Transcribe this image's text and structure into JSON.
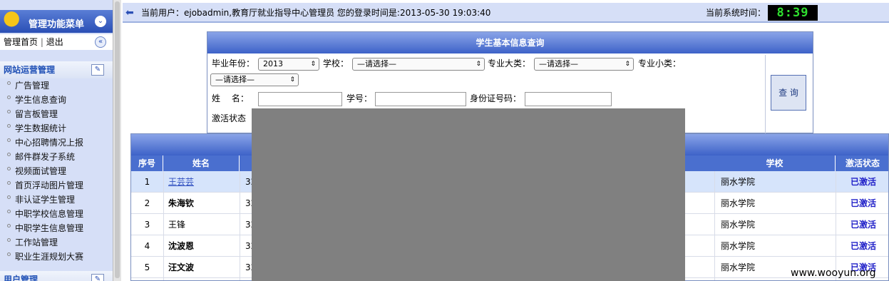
{
  "sidebar": {
    "title": "管理功能菜单",
    "home_link": "管理首页",
    "logout_link": "退出",
    "section_label": "网站运营管理",
    "items": [
      {
        "label": "广告管理"
      },
      {
        "label": "学生信息查询"
      },
      {
        "label": "留言板管理"
      },
      {
        "label": "学生数据统计"
      },
      {
        "label": "中心招聘情况上报"
      },
      {
        "label": "邮件群发子系统"
      },
      {
        "label": "视频面试管理"
      },
      {
        "label": "首页浮动图片管理"
      },
      {
        "label": "非认证学生管理"
      },
      {
        "label": "中职学校信息管理"
      },
      {
        "label": "中职学生信息管理"
      },
      {
        "label": "工作站管理"
      },
      {
        "label": "职业生涯规划大赛"
      }
    ],
    "section2_label": "用户管理"
  },
  "topbar": {
    "user_info": "当前用户：ejobadmin,教育厅就业指导中心管理员 您的登录时间是:2013-05-30 19:03:40",
    "time_label": "当前系统时间：",
    "clock": "8:39"
  },
  "query": {
    "title": "学生基本信息查询",
    "year_label": "毕业年份：",
    "year_value": "2013",
    "school_label": "学校：",
    "school_value": "—请选择—",
    "major_label": "专业大类：",
    "major_value": "—请选择—",
    "minor_label": "专业小类：",
    "minor_value": "—请选择—",
    "name_label": "姓　 名：",
    "id_label": "学号：",
    "idcard_label": "身份证号码：",
    "status_label": "激活状态",
    "search_button": "查 询"
  },
  "table": {
    "columns": {
      "no": "序号",
      "name": "姓名",
      "school": "学校",
      "status": "激活状态"
    },
    "rows": [
      {
        "no": "1",
        "name": "王芸芸",
        "id": "32",
        "school": "丽水学院",
        "status": "已激活"
      },
      {
        "no": "2",
        "name": "朱海钦",
        "id": "32",
        "school": "丽水学院",
        "status": "已激活"
      },
      {
        "no": "3",
        "name": "王锋",
        "id": "32",
        "school": "丽水学院",
        "status": "已激活"
      },
      {
        "no": "4",
        "name": "沈波恩",
        "id": "32",
        "school": "丽水学院",
        "status": "已激活"
      },
      {
        "no": "5",
        "name": "汪文波",
        "id": "32",
        "school": "丽水学院",
        "status": "已激活"
      }
    ]
  },
  "watermark": "www.wooyun.org"
}
